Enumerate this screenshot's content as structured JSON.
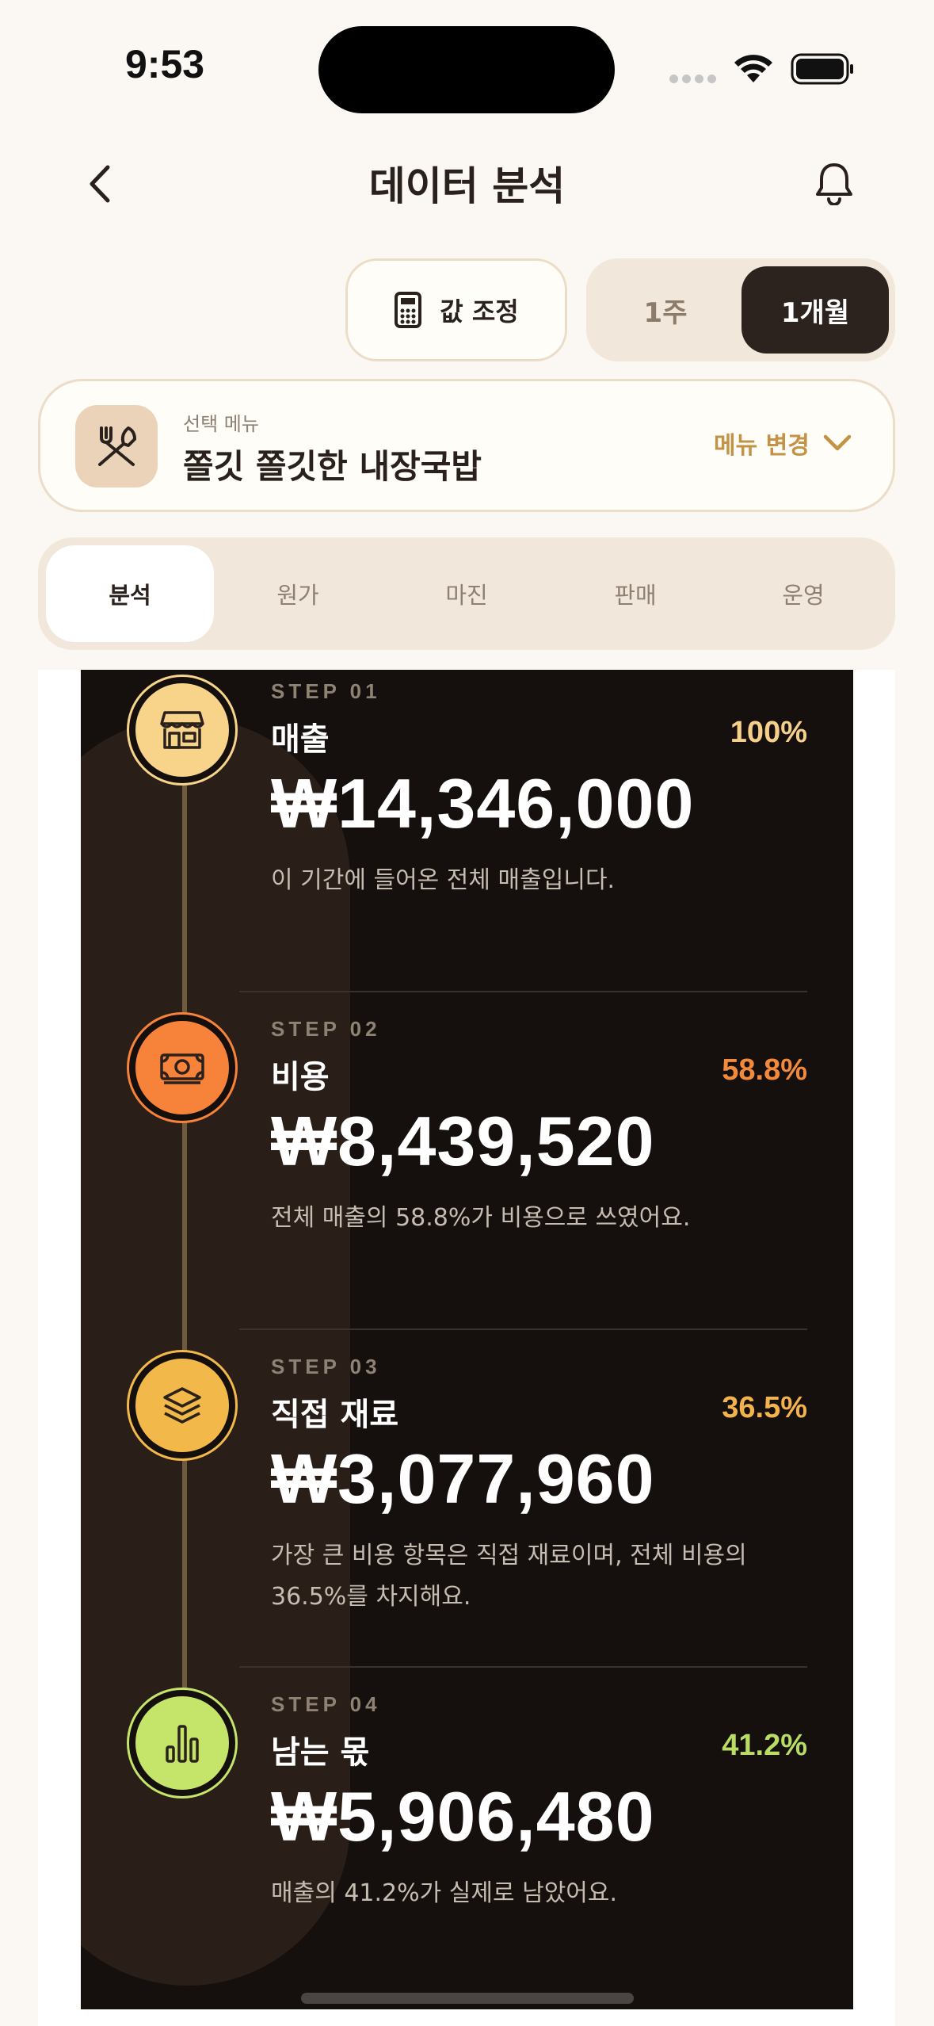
{
  "status_bar": {
    "time": "9:53"
  },
  "header": {
    "title": "데이터 분석",
    "back_icon": "chevron-left-icon",
    "bell_icon": "bell-icon"
  },
  "controls": {
    "adjust_label": "값 조정",
    "adjust_icon": "calculator-icon",
    "period_options": [
      "1주",
      "1개월"
    ],
    "period_selected": "1개월"
  },
  "menu_card": {
    "caption": "선택 메뉴",
    "name": "쫄깃 쫄깃한 내장국밥",
    "change_label": "메뉴 변경",
    "icon": "utensils-icon"
  },
  "tabs": [
    {
      "label": "분석",
      "active": true
    },
    {
      "label": "원가",
      "active": false
    },
    {
      "label": "마진",
      "active": false
    },
    {
      "label": "판매",
      "active": false
    },
    {
      "label": "운영",
      "active": false
    }
  ],
  "steps": [
    {
      "label": "STEP 01",
      "title": "매출",
      "percent": "100%",
      "amount": "₩14,346,000",
      "desc": "이 기간에 들어온 전체 매출입니다.",
      "color": "#F7D48A",
      "percent_color": "#F5D08A",
      "icon": "store-icon"
    },
    {
      "label": "STEP 02",
      "title": "비용",
      "percent": "58.8%",
      "amount": "₩8,439,520",
      "desc": "전체 매출의 58.8%가 비용으로 쓰였어요.",
      "color": "#F7823A",
      "percent_color": "#F28A3C",
      "icon": "money-icon"
    },
    {
      "label": "STEP 03",
      "title": "직접 재료",
      "percent": "36.5%",
      "amount": "₩3,077,960",
      "desc": "가장 큰 비용 항목은 직접 재료이며, 전체 비용의 36.5%를 차지해요.",
      "color": "#F2B84A",
      "percent_color": "#F2B24C",
      "icon": "layers-icon"
    },
    {
      "label": "STEP 04",
      "title": "남는 몫",
      "percent": "41.2%",
      "amount": "₩5,906,480",
      "desc": "매출의 41.2%가 실제로 남았어요.",
      "color": "#C5E56A",
      "percent_color": "#B8DC64",
      "icon": "bar-chart-icon"
    }
  ]
}
